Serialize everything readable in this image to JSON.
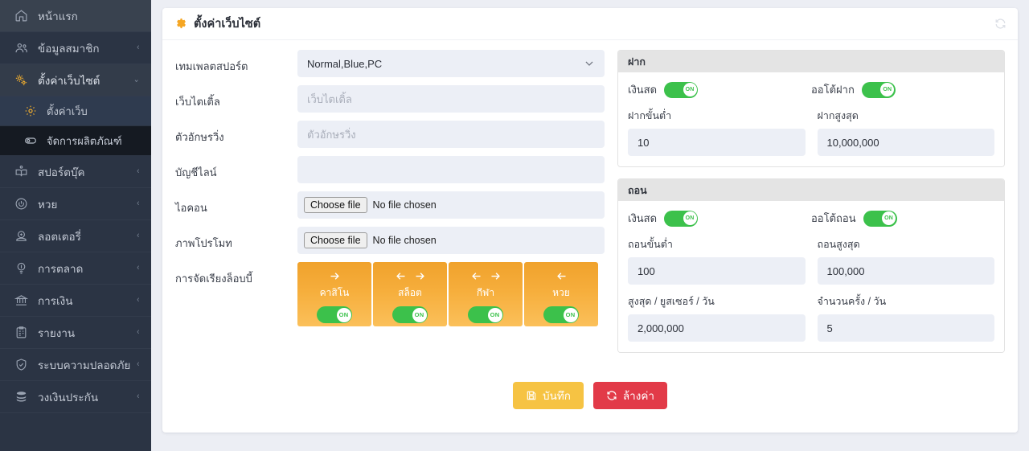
{
  "sidebar": {
    "items": [
      {
        "label": "หน้าแรก",
        "icon": "home-icon",
        "caret": "",
        "state": "home"
      },
      {
        "label": "ข้อมูลสมาชิก",
        "icon": "users-icon",
        "caret": "‹",
        "state": "normal"
      },
      {
        "label": "ตั้งค่าเว็บไซต์",
        "icon": "gears-icon",
        "caret": "⌄",
        "state": "expanded"
      }
    ],
    "subitems": [
      {
        "label": "ตั้งค่าเว็บ",
        "icon": "gear-icon",
        "state": "active"
      },
      {
        "label": "จัดการผลิตภัณฑ์",
        "icon": "toggle-icon",
        "state": "dark"
      }
    ],
    "items_after": [
      {
        "label": "สปอร์ตบุ๊ค",
        "icon": "book-icon",
        "caret": "‹"
      },
      {
        "label": "หวย",
        "icon": "power-icon",
        "caret": "‹"
      },
      {
        "label": "ลอตเตอรี่",
        "icon": "lottery-icon",
        "caret": "‹"
      },
      {
        "label": "การตลาด",
        "icon": "bulb-icon",
        "caret": "‹"
      },
      {
        "label": "การเงิน",
        "icon": "bank-icon",
        "caret": "‹"
      },
      {
        "label": "รายงาน",
        "icon": "clipboard-icon",
        "caret": "‹"
      },
      {
        "label": "ระบบความปลอดภัย",
        "icon": "shield-icon",
        "caret": "‹"
      },
      {
        "label": "วงเงินประกัน",
        "icon": "database-icon",
        "caret": "‹"
      }
    ]
  },
  "header": {
    "title": "ตั้งค่าเว็บไซต์",
    "gear_icon": "gear-icon",
    "refresh_icon": "refresh-icon"
  },
  "form": {
    "template": {
      "label": "เทมเพลตสปอร์ต",
      "value": "Normal,Blue,PC"
    },
    "web_title": {
      "label": "เว็บไตเติ้ล",
      "value": "",
      "placeholder": "เว็บไตเติ้ล"
    },
    "running_text": {
      "label": "ตัวอักษรวิ่ง",
      "value": "",
      "placeholder": "ตัวอักษรวิ่ง"
    },
    "line_account": {
      "label": "บัญชีไลน์",
      "value": "",
      "placeholder": ""
    },
    "icon_file": {
      "label": "ไอคอน",
      "button": "Choose file",
      "status": "No file chosen"
    },
    "promo_file": {
      "label": "ภาพโปรโมท",
      "button": "Choose file",
      "status": "No file chosen"
    },
    "lobby": {
      "label": "การจัดเรียงล็อบบี้",
      "tiles": [
        {
          "name": "คาสิโน",
          "arrows": [
            "right"
          ],
          "toggle": "ON"
        },
        {
          "name": "สล็อต",
          "arrows": [
            "left",
            "right"
          ],
          "toggle": "ON"
        },
        {
          "name": "กีฬา",
          "arrows": [
            "left",
            "right"
          ],
          "toggle": "ON"
        },
        {
          "name": "หวย",
          "arrows": [
            "left"
          ],
          "toggle": "ON"
        }
      ]
    }
  },
  "deposit": {
    "title": "ฝาก",
    "cash": {
      "label": "เงินสด",
      "toggle": "ON"
    },
    "auto": {
      "label": "ออโต้ฝาก",
      "toggle": "ON"
    },
    "min": {
      "label": "ฝากขั้นต่ำ",
      "value": "10"
    },
    "max": {
      "label": "ฝากสูงสุด",
      "value": "10,000,000"
    }
  },
  "withdraw": {
    "title": "ถอน",
    "cash": {
      "label": "เงินสด",
      "toggle": "ON"
    },
    "auto": {
      "label": "ออโต้ถอน",
      "toggle": "ON"
    },
    "min": {
      "label": "ถอนขั้นต่ำ",
      "value": "100"
    },
    "max": {
      "label": "ถอนสูงสุด",
      "value": "100,000"
    },
    "max_per_user": {
      "label": "สูงสุด / ยูสเซอร์ / วัน",
      "value": "2,000,000"
    },
    "times_per_day": {
      "label": "จำนวนครั้ง / วัน",
      "value": "5"
    }
  },
  "actions": {
    "save": {
      "label": "บันทึก",
      "icon": "save-icon",
      "color": "#f6c343"
    },
    "reset": {
      "label": "ล้างค่า",
      "icon": "refresh-icon",
      "color": "#e23a48"
    }
  }
}
